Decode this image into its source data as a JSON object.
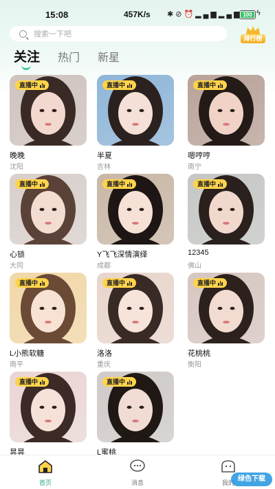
{
  "status_bar": {
    "time": "15:08",
    "network_speed": "457K/s",
    "icons": [
      "bluetooth-icon",
      "mute-icon",
      "alarm-icon",
      "signal-hd-icon",
      "signal-hd2-icon",
      "wifi-icon"
    ],
    "battery_level": "100",
    "battery_fraction": 1.0
  },
  "search": {
    "placeholder": "搜索一下吧"
  },
  "rank_button": {
    "label": "排行榜",
    "icon": "crown-icon"
  },
  "tabs": [
    {
      "label": "关注",
      "active": true
    },
    {
      "label": "热门",
      "active": false
    },
    {
      "label": "新星",
      "active": false
    }
  ],
  "live_badge": "直播中",
  "streamers": [
    {
      "name": "晚晚",
      "city": "沈阳"
    },
    {
      "name": "半夏",
      "city": "吉林"
    },
    {
      "name": "嗯哼哼",
      "city": "南宁"
    },
    {
      "name": "心锁",
      "city": "大同"
    },
    {
      "name": "Y飞飞深情演绎",
      "city": "成都"
    },
    {
      "name": "12345",
      "city": "佛山"
    },
    {
      "name": "L小熊软糖",
      "city": "南平"
    },
    {
      "name": "洛洛",
      "city": "重庆"
    },
    {
      "name": "花桃桃",
      "city": "衡阳"
    },
    {
      "name": "昙昙",
      "city": ""
    },
    {
      "name": "L蜜桃",
      "city": ""
    }
  ],
  "nav": [
    {
      "label": "首页",
      "icon": "home-icon",
      "active": true
    },
    {
      "label": "消息",
      "icon": "message-icon",
      "active": false
    },
    {
      "label": "我的",
      "icon": "profile-icon",
      "active": false
    }
  ],
  "watermark": "绿色下载"
}
